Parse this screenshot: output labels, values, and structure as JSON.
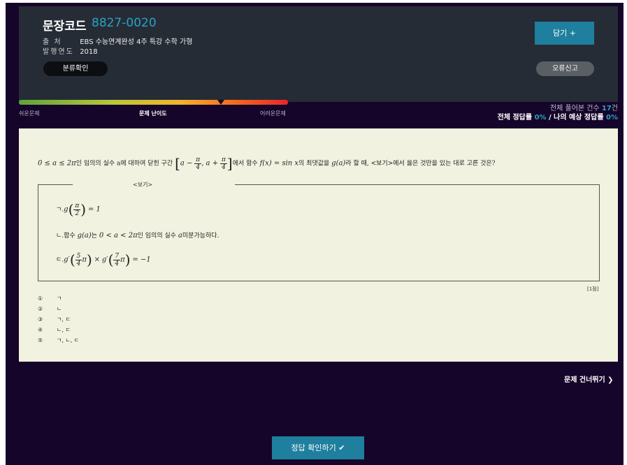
{
  "header": {
    "code_label": "문장코드",
    "code_value": "8827-0020",
    "source_key": "출 처",
    "source_value": "EBS 수능연계완성 4주 특강 수학 가형",
    "year_key": "발행연도",
    "year_value": "2018",
    "classify_button": "분류확인",
    "save_button": "담기 +",
    "report_button": "오류신고"
  },
  "difficulty": {
    "easy_label": "쉬운문제",
    "center_label": "문제 난이도",
    "hard_label": "어려운문제",
    "level": 0.75,
    "colors": [
      "#5da43c",
      "#f4b22c",
      "#e8262b"
    ]
  },
  "stats": {
    "total_prefix": "전체 풀어본 건수 ",
    "total_value": "17",
    "total_suffix": "건",
    "correct_prefix": "전체 정답률 ",
    "correct_value": "0%",
    "my_prefix": " / 나의 예상 정답률 ",
    "my_value": "0%"
  },
  "question": {
    "cond": "0 ≤ a ≤ 2π",
    "part1": "인 임의의 실수 a에 대하여 닫힌 구간",
    "interval_a": "a −",
    "interval_b": ", a +",
    "pi": "π",
    "four": "4",
    "part2": "에서 함수",
    "func": "f(x) = sin x",
    "part3": "의 최댓값을",
    "ga": "g(a)",
    "part4": "라 할 때, <보기>에서 옳은 것만을 있는 대로 고른 것은?"
  },
  "bogi": {
    "title": "<보기>",
    "item1_prefix": "ㄱ.",
    "item1_g": "g",
    "item1_num": "π",
    "item1_den": "2",
    "item1_rhs": "= 1",
    "item2_prefix": "ㄴ.함수",
    "item2_ga": "g(a)",
    "item2_mid": "는",
    "item2_range": "0 < a < 2π",
    "item2_text": "인 임의의 실수",
    "item2_a": "a",
    "item2_end": "미분가능하다.",
    "item3_prefix": "ㄷ.",
    "item3_g1": "g′",
    "item3_n1": "5",
    "item3_d1": "4",
    "item3_pi1": "π",
    "item3_times": "×",
    "item3_g2": "g′",
    "item3_n2": "7",
    "item3_d2": "4",
    "item3_pi2": "π",
    "item3_rhs": "= −1"
  },
  "score": "[1점]",
  "choices": [
    {
      "num": "①",
      "text": "ㄱ"
    },
    {
      "num": "②",
      "text": "ㄴ"
    },
    {
      "num": "③",
      "text": "ㄱ, ㄷ"
    },
    {
      "num": "④",
      "text": "ㄴ, ㄷ"
    },
    {
      "num": "⑤",
      "text": "ㄱ, ㄴ, ㄷ"
    }
  ],
  "skip_label": "문제 건너뛰기",
  "check_button": "정답 확인하기"
}
